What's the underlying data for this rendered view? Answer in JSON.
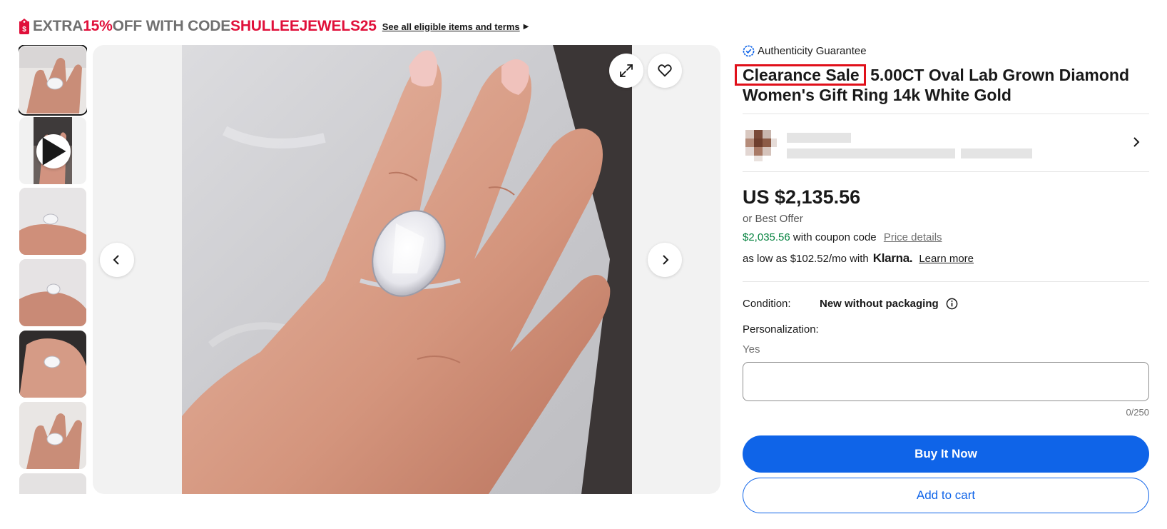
{
  "promo": {
    "text_1": "EXTRA ",
    "percent": "15%",
    "text_2": " OFF WITH CODE ",
    "code": "SHULLEEJEWELS25",
    "link": "See all eligible items and terms"
  },
  "thumbnails": [
    {
      "kind": "image",
      "selected": true
    },
    {
      "kind": "video",
      "selected": false
    },
    {
      "kind": "image",
      "selected": false
    },
    {
      "kind": "image",
      "selected": false
    },
    {
      "kind": "image",
      "selected": false
    },
    {
      "kind": "image",
      "selected": false
    },
    {
      "kind": "image",
      "selected": false
    }
  ],
  "gallery": {
    "icons": [
      "expand-icon",
      "heart-icon",
      "chevron-left-icon",
      "chevron-right-icon"
    ]
  },
  "product": {
    "authenticity": "Authenticity Guarantee",
    "title_highlight": "Clearance Sale",
    "title_rest": "5.00CT Oval Lab Grown Diamond Women's Gift Ring 14k White Gold",
    "price": "US $2,135.56",
    "best_offer": "or Best Offer",
    "coupon_price": "$2,035.56",
    "coupon_text": "with coupon code",
    "price_details": "Price details",
    "klarna_prefix": "as low as $102.52/mo with",
    "klarna_logo": "Klarna.",
    "learn_more": "Learn more"
  },
  "details": {
    "condition_label": "Condition:",
    "condition_value": "New without packaging",
    "personalization_label": "Personalization:",
    "personalization_value": "Yes",
    "char_counter": "0/250"
  },
  "actions": {
    "buy_now": "Buy It Now",
    "add_to_cart": "Add to cart"
  },
  "colors": {
    "accent_blue": "#0f64e8",
    "promo_red": "#e0103a",
    "coupon_green": "#05823f",
    "highlight_box": "#e0101a"
  }
}
